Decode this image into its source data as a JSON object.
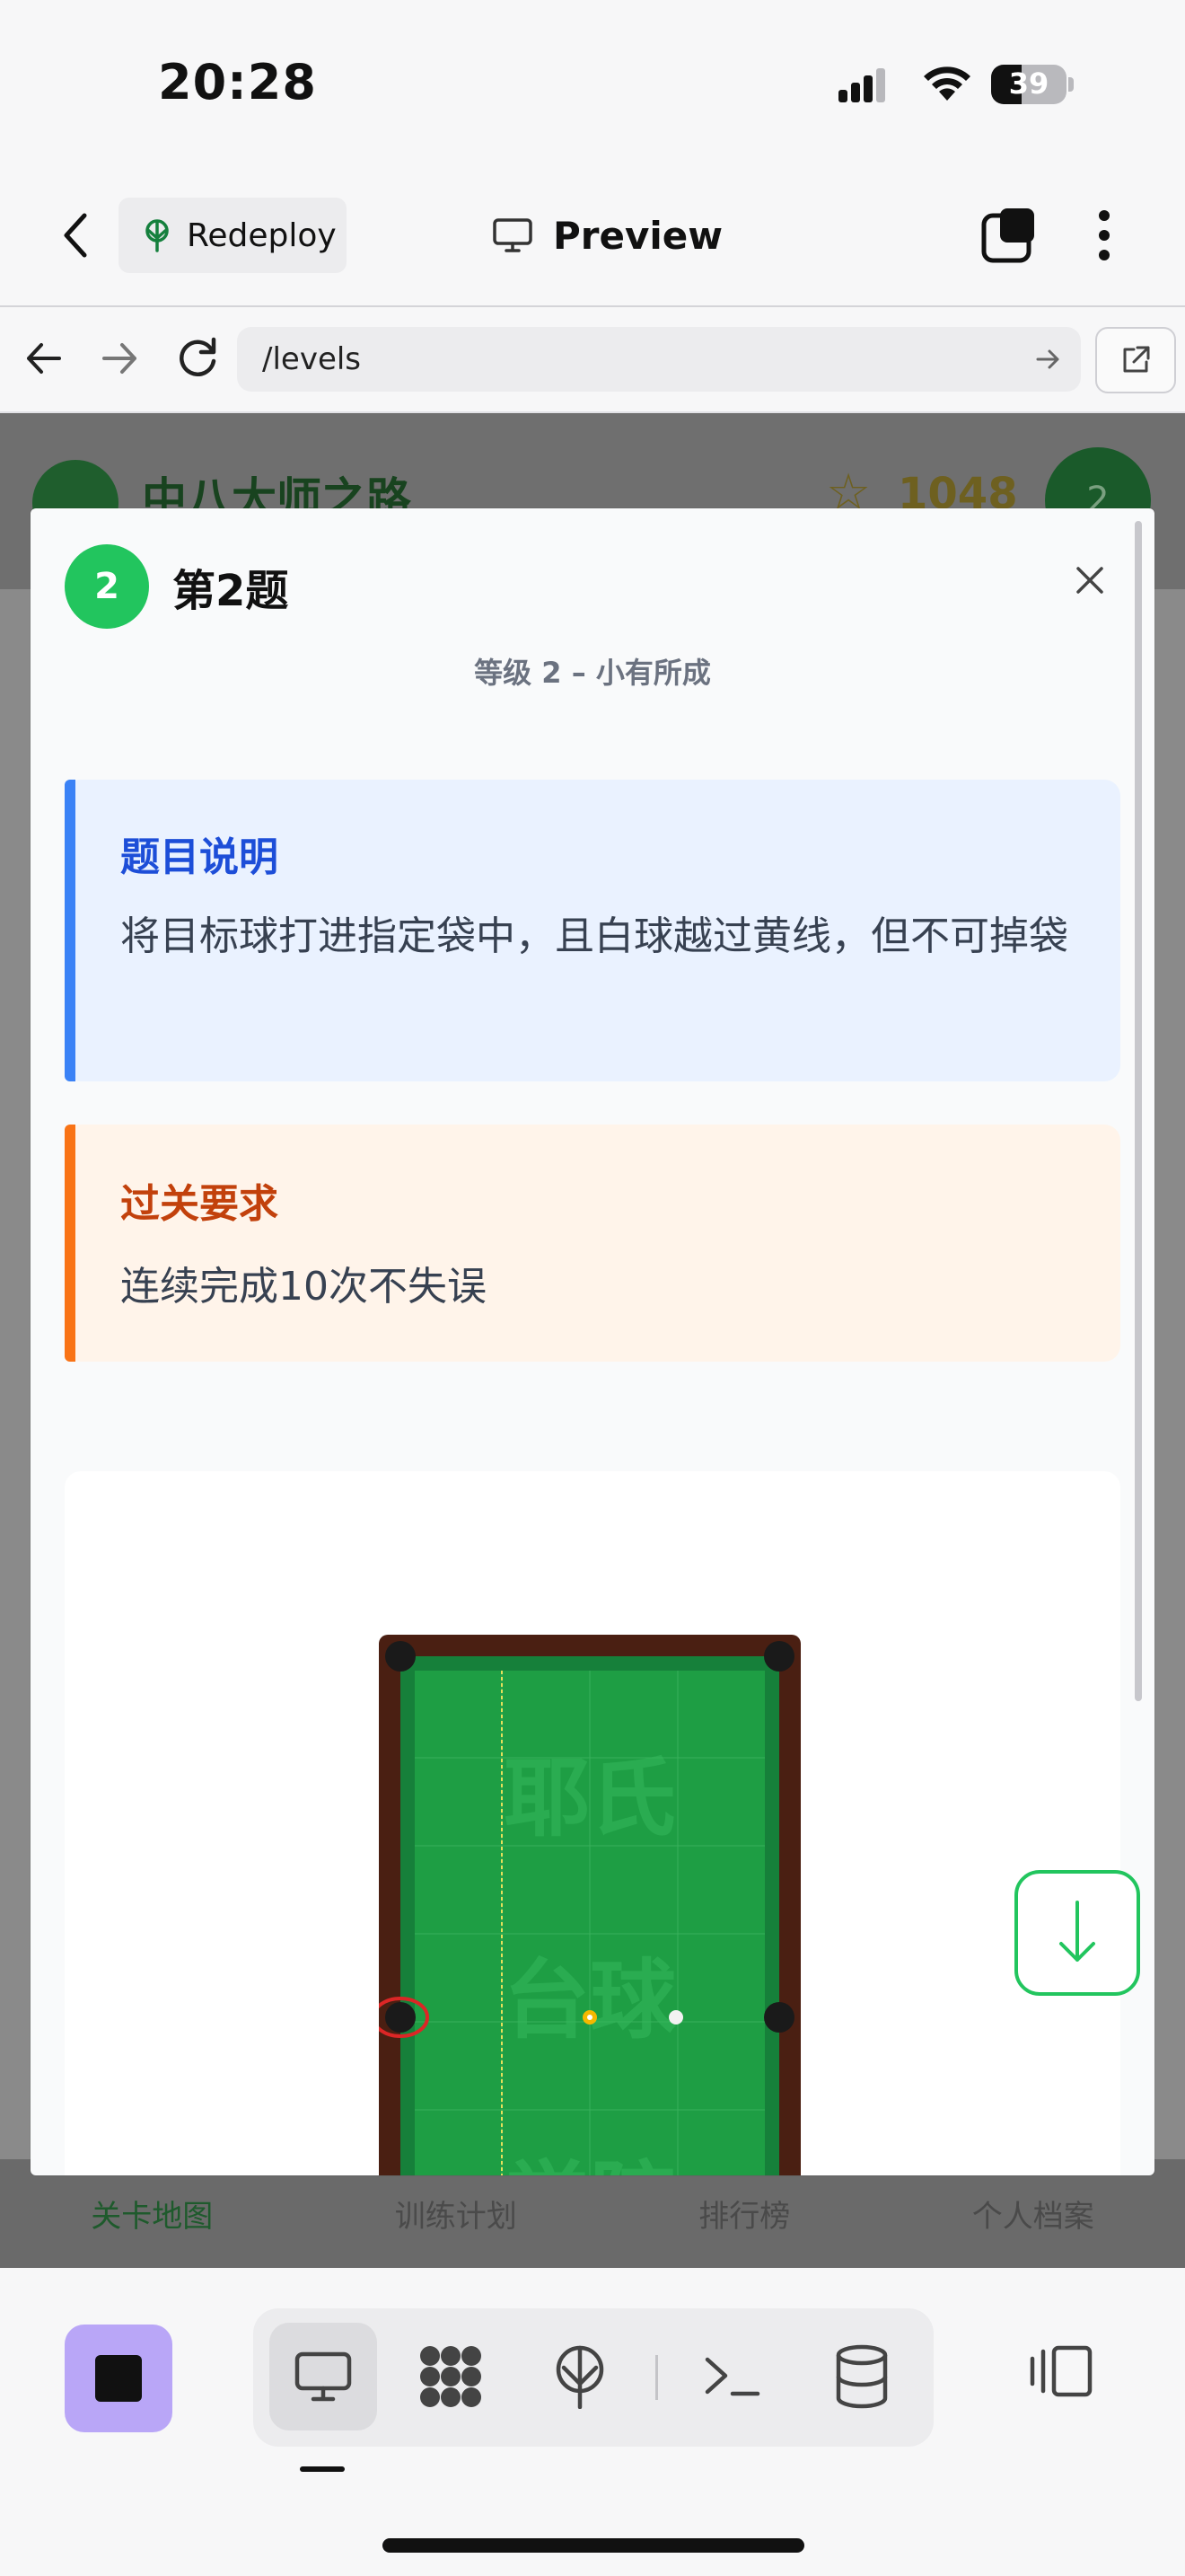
{
  "status_bar": {
    "time": "20:28",
    "battery": "39"
  },
  "header": {
    "redeploy_label": "Redeploy",
    "preview_label": "Preview"
  },
  "browser": {
    "url": "/levels"
  },
  "background_app": {
    "title": "中八大师之路",
    "score": "1048",
    "avatar_text": "2",
    "nav_items": [
      "关卡地图",
      "训练计划",
      "排行榜",
      "个人档案"
    ]
  },
  "modal": {
    "level_number": "2",
    "title": "第2题",
    "subtitle": "等级 2 – 小有所成",
    "description_title": "题目说明",
    "description_text": "将目标球打进指定袋中，且白球越过黄线，但不可掉袋",
    "requirement_title": "过关要求",
    "requirement_text": "连续完成10次不失误",
    "table_watermark_lines": [
      "耶氏",
      "台球",
      "学院"
    ]
  },
  "colors": {
    "accent_green": "#22c55e",
    "info_blue": "#3b82f6",
    "warning_orange": "#f97316",
    "table_felt": "#1e9e44",
    "table_rail": "#4a1f12"
  },
  "icons": [
    "back-icon",
    "redeploy-icon",
    "monitor-icon",
    "tabs-icon",
    "more-icon",
    "nav-back-icon",
    "nav-forward-icon",
    "reload-icon",
    "go-arrow-icon",
    "external-link-icon",
    "close-icon",
    "arrow-down-icon",
    "stop-icon",
    "desktop-icon",
    "apps-icon",
    "deploy-icon",
    "terminal-icon",
    "database-icon",
    "panel-icon"
  ]
}
